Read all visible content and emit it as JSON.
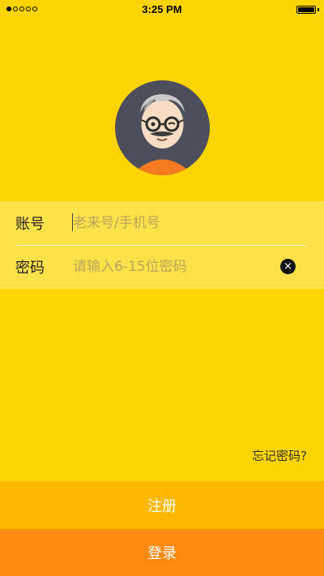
{
  "status_bar": {
    "time": "3:25 PM"
  },
  "login_form": {
    "account_label": "账号",
    "account_placeholder": "老来号/手机号",
    "password_label": "密码",
    "password_placeholder": "请输入6-15位密码",
    "clear_icon": "close-icon"
  },
  "links": {
    "forgot_password": "忘记密码?"
  },
  "buttons": {
    "register": "注册",
    "login": "登录"
  },
  "colors": {
    "background": "#ffd400",
    "form_background": "#ffe14a",
    "register_button": "#ffb800",
    "login_button": "#ff8a12"
  }
}
